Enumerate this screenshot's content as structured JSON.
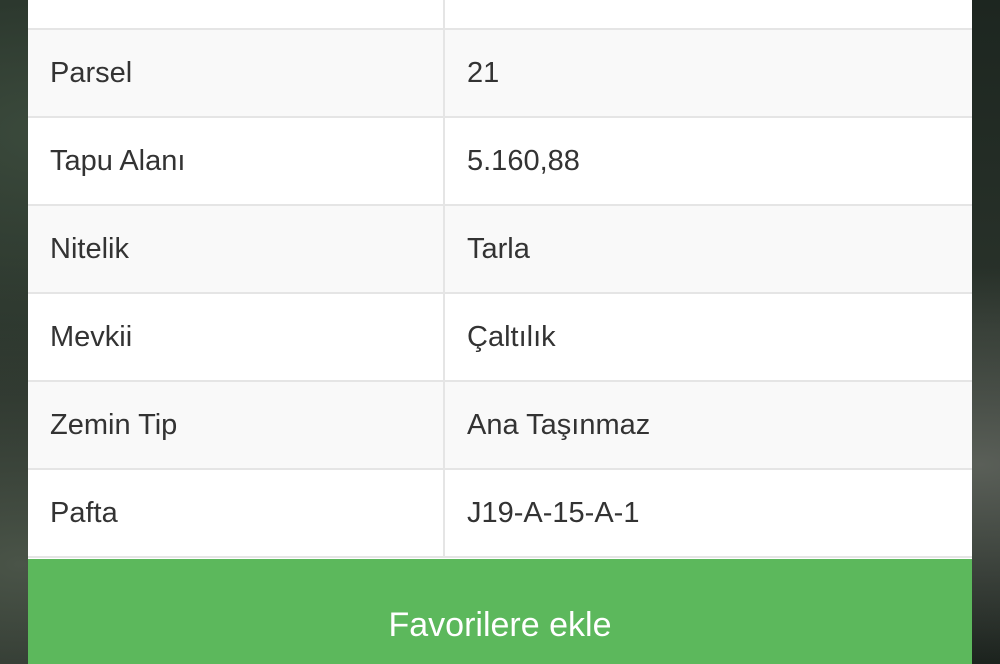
{
  "rows": [
    {
      "label": "",
      "value": ""
    },
    {
      "label": "Parsel",
      "value": "21"
    },
    {
      "label": "Tapu Alanı",
      "value": "5.160,88"
    },
    {
      "label": "Nitelik",
      "value": "Tarla"
    },
    {
      "label": "Mevkii",
      "value": "Çaltılık"
    },
    {
      "label": "Zemin Tip",
      "value": "Ana Taşınmaz"
    },
    {
      "label": "Pafta",
      "value": "J19-A-15-A-1"
    }
  ],
  "favorite_button": {
    "label": "Favorilere ekle"
  },
  "colors": {
    "button_bg": "#5cb85c",
    "button_text": "#ffffff",
    "row_alt_bg": "#f9f9f9",
    "border": "#e5e5e5",
    "text": "#333333"
  }
}
